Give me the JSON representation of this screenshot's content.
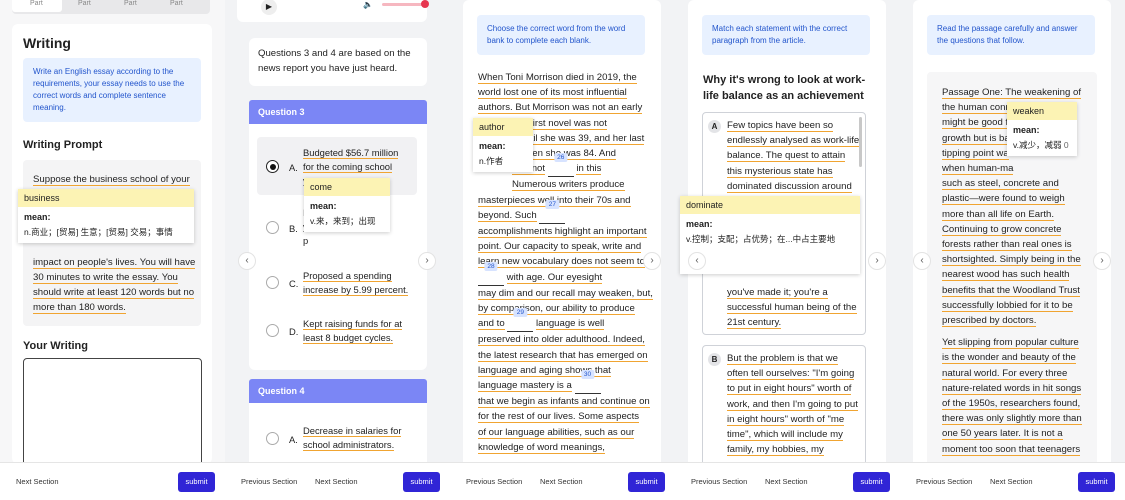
{
  "panel1": {
    "tabs": [
      "Part",
      "Part",
      "Part",
      "Part"
    ],
    "title": "Writing",
    "hint": "Write an English essay according to the requirements, your essay needs to use the correct words and complete sentence meaning.",
    "prompt_heading": "Writing Prompt",
    "prompt_lines": [
      "Suppose the business school of your",
      "impact on people's lives. You will have",
      "30 minutes to write the essay. You",
      "should write at least 120 words but no",
      "more than 180 words."
    ],
    "popup_word": "business",
    "popup_meaning_label": "mean:",
    "popup_def": "n.商业；[贸易] 生意；[贸易] 交易；事情",
    "your_writing": "Your Writing",
    "footer_next": "Next Section",
    "submit": "submit"
  },
  "panel2": {
    "intro": "Questions 3 and 4 are based on the news report you have just heard.",
    "q3_head": "Question 3",
    "q4_head": "Question 4",
    "optA_letter": "A.",
    "optA_lines": [
      "Budgeted $56.7 million",
      "for the coming school",
      "y"
    ],
    "optB_letter": "B.",
    "optB_lines": [
      "I",
      "y",
      "p"
    ],
    "optC_letter": "C.",
    "optC_lines": [
      "Proposed a spending",
      "increase by 5.99 percent."
    ],
    "optD_letter": "D.",
    "optD_lines": [
      "Kept raising funds for at",
      "least 8 budget cycles."
    ],
    "q4_optA_letter": "A.",
    "q4_optA_lines": [
      "Decrease in salaries for",
      "school administrators."
    ],
    "popup_word": "come",
    "popup_meaning_label": "mean:",
    "popup_def": "v.来，来到；出现",
    "footer_prev": "Previous Section",
    "footer_next": "Next Section",
    "submit": "submit"
  },
  "panel3": {
    "hint": "Choose the correct word from the word bank to complete each blank.",
    "lines": [
      "When Toni Morrison died in 2019, the",
      "world lost one of its most influential",
      "authors. But Morrison was not an early",
      "Her first novel was not",
      "d until she was 39, and her last",
      "d when she was 84. And",
      "was not",
      "in this",
      "Numerous writers produce",
      "masterpieces well into their 70s and",
      "beyond. Such",
      "accomplishments highlight an important",
      "point. Our capacity to speak, write and",
      "learn new vocabulary does not seem to",
      "with age. Our eyesight",
      "may dim and our recall may weaken, but,",
      "by comparison, our ability to produce",
      "and to",
      "language is well",
      "preserved into older adulthood. Indeed,",
      "the latest research that has emerged on",
      "language and aging shows that",
      "language mastery is a",
      "that we begin as infants and continue on",
      "for the rest of our lives. Some aspects",
      "of our language abilities, such as our",
      "knowledge of word meanings,"
    ],
    "blanks": [
      "26",
      "27",
      "28",
      "29",
      "30"
    ],
    "popup_word": "author",
    "popup_meaning_label": "mean:",
    "popup_def": "n.作者",
    "footer_prev": "Previous Section",
    "footer_next": "Next Section",
    "submit": "submit"
  },
  "panel4": {
    "top_text": "Match each statement with the correct paragraph from the article.",
    "article_title": "Why it's wrong to look at work-life balance as an achievement",
    "para_a_label": "A",
    "para_a_lines": [
      "Few topics have been so",
      "endlessly analysed as work-life",
      "balance. The quest to attain",
      "this mysterious state has",
      "dominated discussion around"
    ],
    "para_a_tail": [
      "you've made it; you're a",
      "successful human being of the",
      "21st century."
    ],
    "para_b_label": "B",
    "para_b_lines": [
      "But the problem is that we",
      "often tell ourselves: \"I'm going",
      "to put in eight hours\" worth of",
      "work, and then I'm going to put",
      "in eight hours\" worth of \"me",
      "time\", which will include my",
      "family, my hobbies, my"
    ],
    "popup_word": "dominate",
    "popup_meaning_label": "mean:",
    "popup_def": "v.控制；支配；占优势；在...中占主要地",
    "footer_prev": "Previous Section",
    "footer_next": "Next Section",
    "submit": "submit"
  },
  "panel5": {
    "hint": "Read the passage carefully and answer the questions that follow.",
    "para1": [
      "Passage One: The weakening of",
      "the human conn",
      "might be good f",
      "growth but is ba",
      "tipping point wa",
      "when human-ma",
      "such as steel, concrete and",
      "plastic—were found to weigh",
      "more than all life on Earth.",
      "Continuing to grow concrete",
      "forests rather than real ones is",
      "shortsighted. Simply being in the",
      "nearest wood has such health",
      "benefits that the Woodland Trust",
      "successfully lobbied for it to be",
      "prescribed by doctors."
    ],
    "para2": [
      "Yet slipping from popular culture",
      "is the wonder and beauty of the",
      "natural world. For every three",
      "nature-related words in hit songs",
      "of the 1950s, researchers found,",
      "there was only slightly more than",
      "one 50 years later. It is not a",
      "moment too soon that teenagers"
    ],
    "popup_word": "weaken",
    "popup_meaning_label": "mean:",
    "popup_def": "v.减少，减弱",
    "popup_extra": "0",
    "footer_prev": "Previous Section",
    "footer_next": "Next Section",
    "submit": "submit"
  },
  "icons": {
    "prev": "‹",
    "next": "›"
  },
  "colors": {
    "accent": "#3025d6",
    "underline": "#f0a431",
    "question_head": "#7b86f5",
    "hint_bg": "#e8f1ff",
    "popup_word_bg": "#fcf3b4"
  }
}
